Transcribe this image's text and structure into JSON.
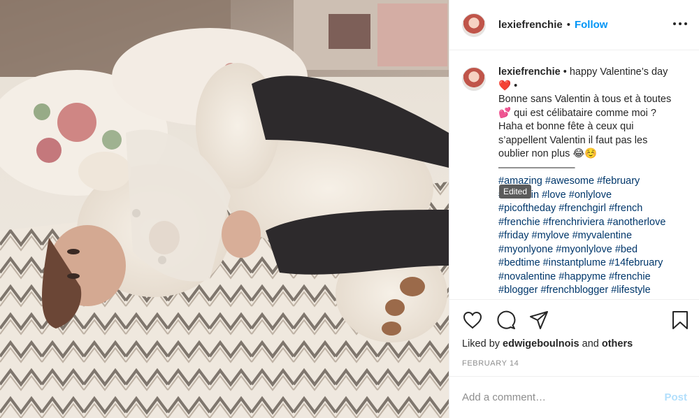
{
  "post": {
    "username": "lexiefrenchie",
    "header_separator": "•",
    "follow_label": "Follow",
    "caption": {
      "line1": "happy Valentine’s day",
      "line2": "❤️ •",
      "line3": "Bonne sans Valentin à tous et à toutes",
      "line4": "💕 qui est célibataire comme moi ?",
      "line5": "Haha et bonne fête à ceux qui",
      "line6": "s’appellent Valentin il faut pas les",
      "line7": "oublier non plus 😂☺️",
      "divider": "———————–"
    },
    "caption_separator": "•",
    "hashtag_lines": [
      "#amazing #awesome #february",
      "#valentin #love #onlylove",
      "#picoftheday #frenchgirl #french",
      "#frenchie #frenchriviera #anotherlove",
      "#friday #mylove #myvalentine",
      "#myonlyone #myonlylove #bed",
      "#bedtime #instantplume #14february",
      "#novalentine #happyme #frenchie",
      "#blogger #frenchblogger #lifestyle"
    ],
    "tooltip": "Edited",
    "likes": {
      "prefix": "Liked by",
      "user": "edwigeboulnois",
      "connector": "and",
      "others": "others"
    },
    "date": "FEBRUARY 14",
    "comment_placeholder": "Add a comment…",
    "post_label": "Post"
  },
  "icons": {
    "more": "more-options-icon",
    "like": "heart-icon",
    "comment": "comment-icon",
    "share": "paper-plane-icon",
    "save": "bookmark-icon"
  },
  "colors": {
    "link_blue": "#0095f6",
    "hashtag": "#00376b",
    "post_disabled": "#b2dffc",
    "muted": "#8e8e8e",
    "text": "#262626"
  }
}
